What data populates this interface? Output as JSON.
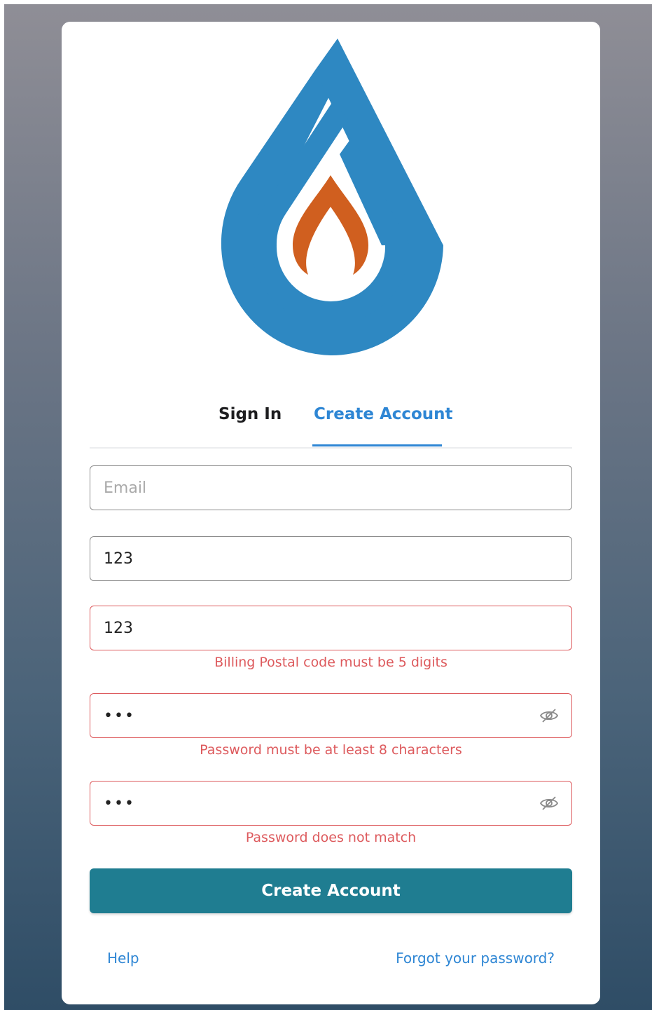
{
  "colors": {
    "accent": "#2e86d4",
    "primary_button": "#1f7d91",
    "error": "#dd5a5d",
    "logo_blue": "#2e88c2",
    "logo_flame": "#d05f1f"
  },
  "tabs": [
    {
      "label": "Sign In",
      "active": false
    },
    {
      "label": "Create Account",
      "active": true
    }
  ],
  "form": {
    "email": {
      "value": "",
      "placeholder": "Email"
    },
    "field2": {
      "value": "123"
    },
    "postal": {
      "value": "123",
      "error": "Billing Postal code must be 5 digits"
    },
    "password": {
      "value": "123",
      "error": "Password must be at least 8 characters",
      "icon": "eye-off-icon"
    },
    "confirm_password": {
      "value": "123",
      "error": "Password does not match",
      "icon": "eye-off-icon"
    },
    "submit_label": "Create Account"
  },
  "footer": {
    "help": "Help",
    "forgot": "Forgot your password?"
  }
}
